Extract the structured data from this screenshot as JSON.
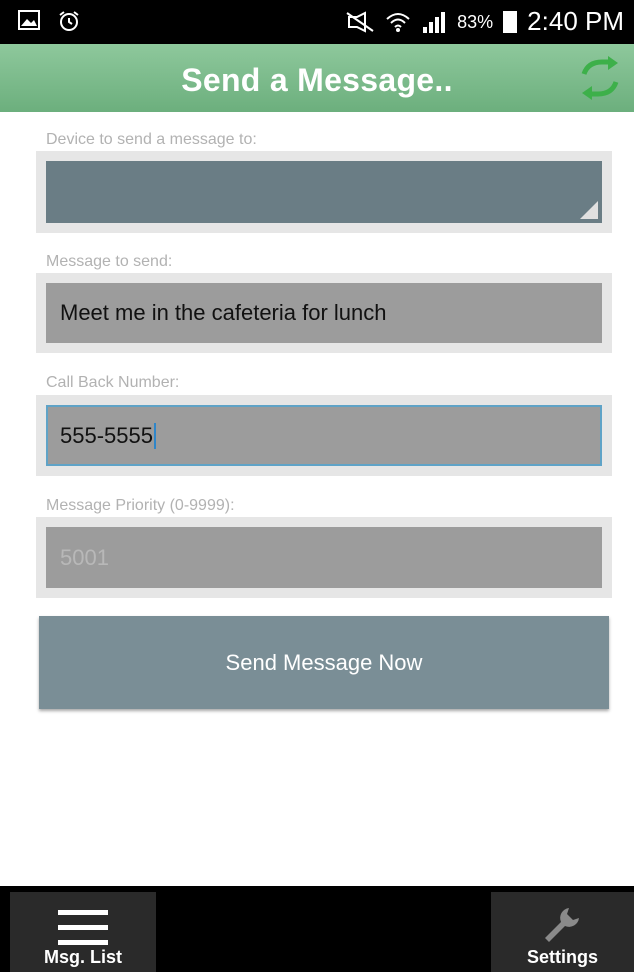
{
  "status_bar": {
    "battery_percent": "83%",
    "time": "2:40 PM",
    "left_icons": [
      "image-icon",
      "alarm-icon"
    ],
    "right_icons": [
      "mute-icon",
      "wifi-icon",
      "signal-icon",
      "battery-icon"
    ]
  },
  "header": {
    "title": "Send a Message..",
    "refresh_icon": "refresh-icon",
    "accent_color": "#7fbf8f"
  },
  "form": {
    "device_label": "Device to send a message to:",
    "device_value": "",
    "message_label": "Message to send:",
    "message_value": "Meet me in the cafeteria for lunch",
    "callback_label": "Call Back Number:",
    "callback_value": "555-5555",
    "priority_label": "Message Priority (0-9999):",
    "priority_placeholder": "5001"
  },
  "send_button": {
    "label": "Send Message Now"
  },
  "bottom_nav": {
    "items": [
      {
        "label": "Msg. List",
        "icon": "menu-icon"
      },
      {
        "label": "Settings",
        "icon": "wrench-icon"
      }
    ]
  }
}
